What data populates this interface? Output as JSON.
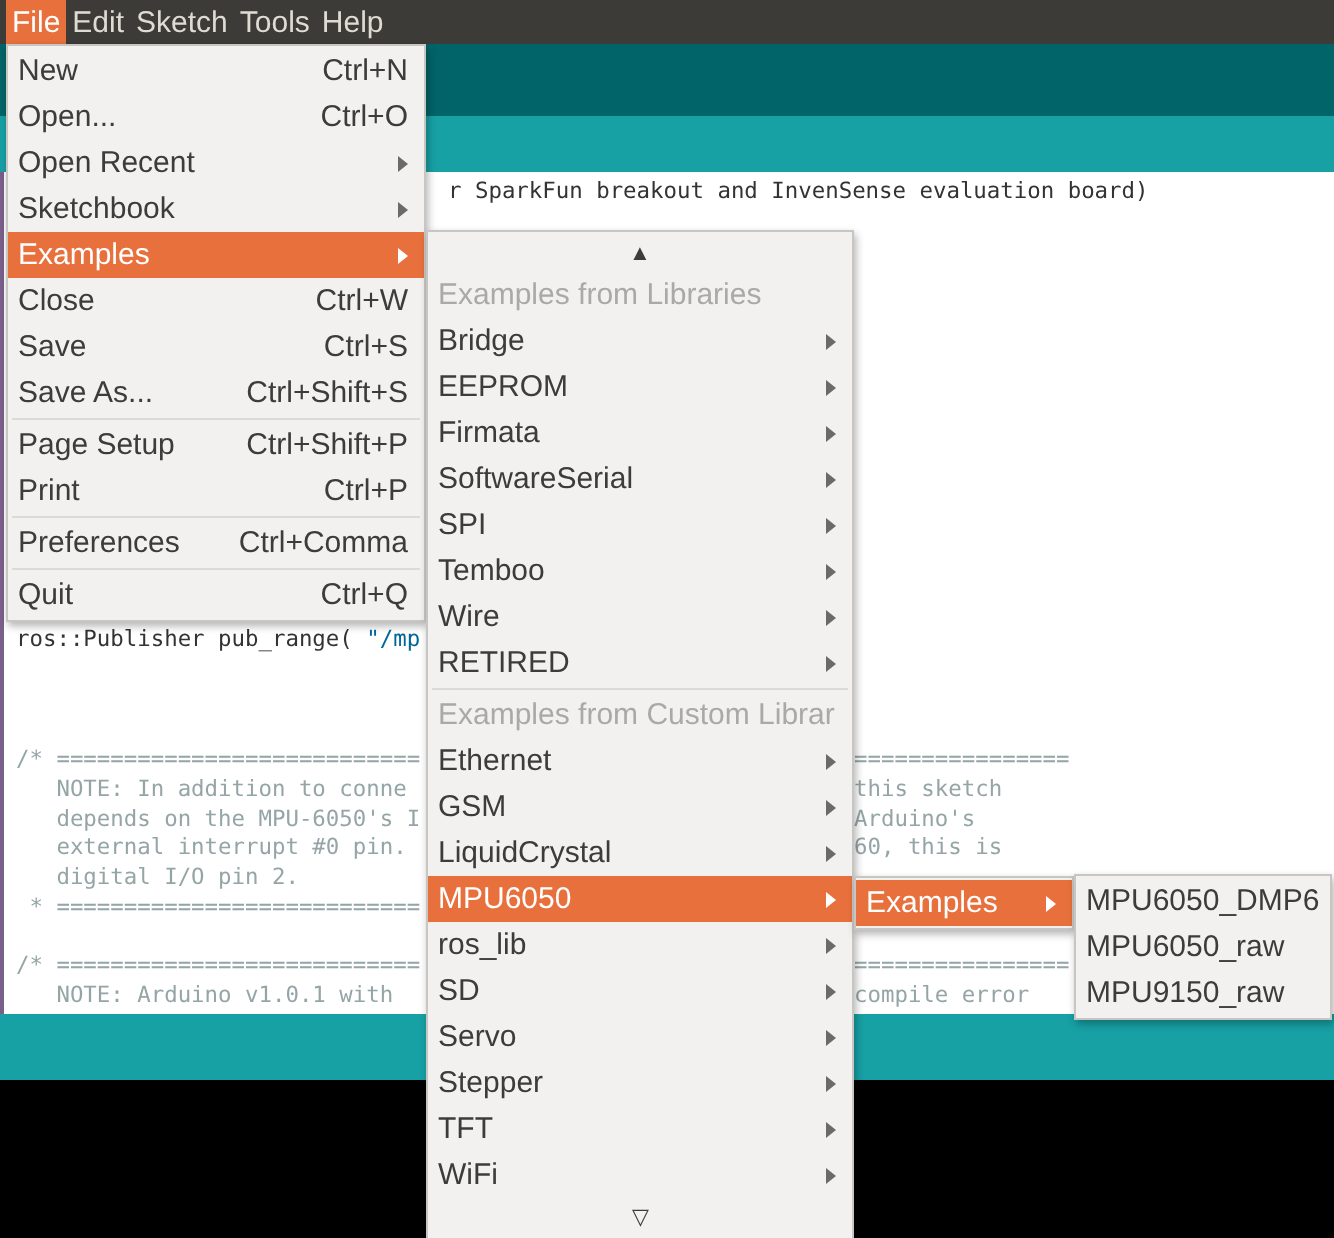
{
  "menubar": [
    {
      "label": "File",
      "selected": true
    },
    {
      "label": "Edit",
      "selected": false
    },
    {
      "label": "Sketch",
      "selected": false
    },
    {
      "label": "Tools",
      "selected": false
    },
    {
      "label": "Help",
      "selected": false
    }
  ],
  "editor": {
    "header_line": "r SparkFun breakout and InvenSense evaluation board)",
    "publisher_line": [
      {
        "text": "ros::Publisher pub_range( ",
        "kind": "code"
      },
      {
        "text": "\"/mp",
        "kind": "string"
      }
    ],
    "comment_blocks": [
      [
        {
          "left": "/* ===========================",
          "right": "================"
        },
        {
          "left": "   NOTE: In addition to conne",
          "right": "this sketch"
        },
        {
          "left": "   depends on the MPU-6050's I",
          "right": "Arduino's"
        },
        {
          "left": "   external interrupt #0 pin.",
          "right": "60, this is"
        },
        {
          "left": "   digital I/O pin 2."
        },
        {
          "left": " * ==========================="
        }
      ],
      [
        {
          "left": "/* ===========================",
          "right": "================"
        },
        {
          "left": "   NOTE: Arduino v1.0.1 with",
          "right": "compile error"
        }
      ]
    ]
  },
  "file_menu": [
    {
      "kind": "item",
      "label": "New",
      "shortcut": "Ctrl+N",
      "submenu": false,
      "selected": false
    },
    {
      "kind": "item",
      "label": "Open...",
      "shortcut": "Ctrl+O",
      "submenu": false,
      "selected": false
    },
    {
      "kind": "item",
      "label": "Open Recent",
      "submenu": true,
      "selected": false
    },
    {
      "kind": "item",
      "label": "Sketchbook",
      "submenu": true,
      "selected": false
    },
    {
      "kind": "item",
      "label": "Examples",
      "submenu": true,
      "selected": true
    },
    {
      "kind": "item",
      "label": "Close",
      "shortcut": "Ctrl+W",
      "submenu": false,
      "selected": false
    },
    {
      "kind": "item",
      "label": "Save",
      "shortcut": "Ctrl+S",
      "submenu": false,
      "selected": false
    },
    {
      "kind": "item",
      "label": "Save As...",
      "shortcut": "Ctrl+Shift+S",
      "submenu": false,
      "selected": false
    },
    {
      "kind": "separator"
    },
    {
      "kind": "item",
      "label": "Page Setup",
      "shortcut": "Ctrl+Shift+P",
      "submenu": false,
      "selected": false
    },
    {
      "kind": "item",
      "label": "Print",
      "shortcut": "Ctrl+P",
      "submenu": false,
      "selected": false
    },
    {
      "kind": "separator"
    },
    {
      "kind": "item",
      "label": "Preferences",
      "shortcut": "Ctrl+Comma",
      "submenu": false,
      "selected": false
    },
    {
      "kind": "separator"
    },
    {
      "kind": "item",
      "label": "Quit",
      "shortcut": "Ctrl+Q",
      "submenu": false,
      "selected": false
    }
  ],
  "examples_menu": [
    {
      "kind": "scroll",
      "label": "▲"
    },
    {
      "kind": "header",
      "label": "Examples from Libraries"
    },
    {
      "kind": "item",
      "label": "Bridge",
      "submenu": true,
      "selected": false
    },
    {
      "kind": "item",
      "label": "EEPROM",
      "submenu": true,
      "selected": false
    },
    {
      "kind": "item",
      "label": "Firmata",
      "submenu": true,
      "selected": false
    },
    {
      "kind": "item",
      "label": "SoftwareSerial",
      "submenu": true,
      "selected": false
    },
    {
      "kind": "item",
      "label": "SPI",
      "submenu": true,
      "selected": false
    },
    {
      "kind": "item",
      "label": "Temboo",
      "submenu": true,
      "selected": false
    },
    {
      "kind": "item",
      "label": "Wire",
      "submenu": true,
      "selected": false
    },
    {
      "kind": "item",
      "label": "RETIRED",
      "submenu": true,
      "selected": false
    },
    {
      "kind": "separator"
    },
    {
      "kind": "header",
      "label": "Examples from Custom Librar"
    },
    {
      "kind": "item",
      "label": "Ethernet",
      "submenu": true,
      "selected": false
    },
    {
      "kind": "item",
      "label": "GSM",
      "submenu": true,
      "selected": false
    },
    {
      "kind": "item",
      "label": "LiquidCrystal",
      "submenu": true,
      "selected": false
    },
    {
      "kind": "item",
      "label": "MPU6050",
      "submenu": true,
      "selected": true
    },
    {
      "kind": "item",
      "label": "ros_lib",
      "submenu": true,
      "selected": false
    },
    {
      "kind": "item",
      "label": "SD",
      "submenu": true,
      "selected": false
    },
    {
      "kind": "item",
      "label": "Servo",
      "submenu": true,
      "selected": false
    },
    {
      "kind": "item",
      "label": "Stepper",
      "submenu": true,
      "selected": false
    },
    {
      "kind": "item",
      "label": "TFT",
      "submenu": true,
      "selected": false
    },
    {
      "kind": "item",
      "label": "WiFi",
      "submenu": true,
      "selected": false
    },
    {
      "kind": "scroll",
      "label": "▽"
    }
  ],
  "mpu_menu": [
    {
      "kind": "item",
      "label": "Examples",
      "submenu": true,
      "selected": true
    }
  ],
  "sketch_menu": [
    {
      "kind": "item",
      "label": "MPU6050_DMP6",
      "selected": false
    },
    {
      "kind": "item",
      "label": "MPU6050_raw",
      "selected": false
    },
    {
      "kind": "item",
      "label": "MPU9150_raw",
      "selected": false
    }
  ]
}
